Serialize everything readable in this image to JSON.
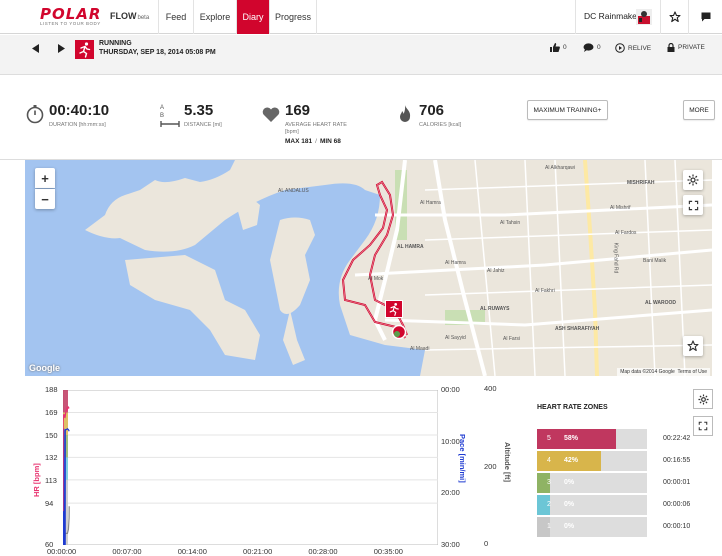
{
  "nav": {
    "brand": "POLAR",
    "brand_tagline": "LISTEN TO YOUR BODY",
    "product": "FLOW",
    "product_badge": "beta",
    "tabs": [
      "Feed",
      "Explore",
      "Diary",
      "Progress"
    ],
    "active_tab": "Diary",
    "user_name": "DC Rainmaker"
  },
  "exercise": {
    "sport": "RUNNING",
    "datetime": "THURSDAY, SEP 18, 2014 05:08 PM",
    "likes": "0",
    "comments": "0",
    "relive_label": "RELIVE",
    "privacy_label": "PRIVATE"
  },
  "stats": {
    "duration": {
      "value": "00:40:10",
      "label": "DURATION [hh:mm:ss]"
    },
    "distance": {
      "value": "5.35",
      "label": "DISTANCE [mi]",
      "icon_text": "A B"
    },
    "heart_rate": {
      "value": "169",
      "label": "AVERAGE HEART RATE",
      "label2": "[bpm]",
      "max_label": "MAX",
      "max": "181",
      "min_label": "MIN",
      "min": "68"
    },
    "calories": {
      "value": "706",
      "label": "CALORIES [kcal]"
    },
    "training_button": "MAXIMUM TRAINING+",
    "more_button": "MORE"
  },
  "map": {
    "zoom_in": "+",
    "zoom_out": "−",
    "copyright": "Map data ©2014 Google",
    "terms": "Terms of Use",
    "provider": "Google",
    "labels": [
      "AL ANDALUS",
      "Al Hamra",
      "AL HAMRA",
      "Al Hamra",
      "Al Mok",
      "Al Maadi",
      "Al Jahiz",
      "Al Tahsin",
      "Al Alkharqawi",
      "MISHRIFAH",
      "Al Mishrif",
      "Al Fardos",
      "Bani Malik",
      "AL RUWAYS",
      "ASH SHARAFIYAH",
      "AL WAROOD",
      "Al Sayyid",
      "Al Farsi",
      "Al Fakhri",
      "King Fahd Rd"
    ]
  },
  "chart": {
    "y_left_title": "HR [bpm]",
    "y_right_title": "Pace [min/mi]",
    "y_alt_title": "Altitude [ft]",
    "hr_ticks": [
      "188",
      "169",
      "150",
      "132",
      "113",
      "94",
      "60"
    ],
    "pace_ticks": [
      "00:00",
      "10:00",
      "20:00",
      "30:00"
    ],
    "alt_ticks": [
      "400",
      "200",
      "0"
    ],
    "x_ticks": [
      "00:00:00",
      "00:07:00",
      "00:14:00",
      "00:21:00",
      "00:28:00",
      "00:35:00"
    ]
  },
  "chart_data": {
    "type": "line",
    "x_label": "",
    "series": [
      {
        "name": "HR [bpm]",
        "color": "#e8336f",
        "x": [
          "00:00",
          "00:01",
          "00:03",
          "00:05",
          "00:07",
          "00:10",
          "00:14",
          "00:18",
          "00:21",
          "00:25",
          "00:28",
          "00:32",
          "00:35",
          "00:38",
          "00:40"
        ],
        "values": [
          88,
          162,
          166,
          168,
          165,
          167,
          166,
          170,
          171,
          173,
          172,
          174,
          174,
          173,
          173
        ]
      },
      {
        "name": "Pace [min/mi]",
        "color": "#1f3bd1",
        "x": [
          "00:00",
          "00:02",
          "00:06",
          "00:07",
          "00:14",
          "00:15",
          "00:17",
          "00:21",
          "00:28",
          "00:35",
          "00:40"
        ],
        "values": [
          "30:00",
          "08:00",
          "07:30",
          "30:00",
          "30:00",
          "07:50",
          "07:40",
          "07:40",
          "07:30",
          "07:40",
          "08:00"
        ]
      },
      {
        "name": "Altitude [ft]",
        "color": "#888888",
        "x": [
          "00:00",
          "00:10",
          "00:14",
          "00:20",
          "00:28",
          "00:35",
          "00:39",
          "00:40"
        ],
        "values": [
          0,
          0,
          30,
          30,
          30,
          40,
          70,
          100
        ]
      }
    ],
    "ylim_hr": [
      60,
      188
    ],
    "ylim_pace": [
      "00:00",
      "30:00"
    ],
    "ylim_altitude": [
      0,
      400
    ]
  },
  "zones": {
    "title": "HEART RATE ZONES",
    "rows": [
      {
        "zone": "5",
        "percent": "58%",
        "fraction": 0.72,
        "color": "#c0375f",
        "time": "00:22:42"
      },
      {
        "zone": "4",
        "percent": "42%",
        "fraction": 0.58,
        "color": "#d8b54b",
        "time": "00:16:55"
      },
      {
        "zone": "3",
        "percent": "0%",
        "fraction": 0.12,
        "color": "#8fb364",
        "time": "00:00:01"
      },
      {
        "zone": "2",
        "percent": "0%",
        "fraction": 0.12,
        "color": "#6cc6d6",
        "time": "00:00:06"
      },
      {
        "zone": "1",
        "percent": "0%",
        "fraction": 0.12,
        "color": "#c7c7c7",
        "time": "00:00:10"
      }
    ]
  }
}
